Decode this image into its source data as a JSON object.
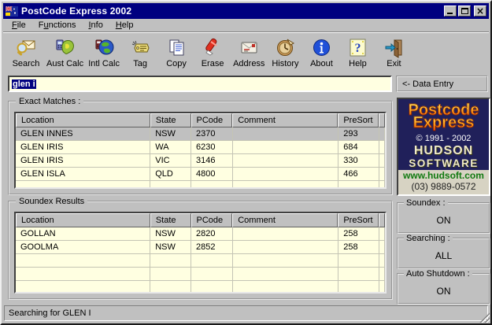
{
  "window": {
    "title": "PostCode Express 2002",
    "controls": [
      {
        "name": "minimize-button"
      },
      {
        "name": "maximize-button"
      },
      {
        "name": "close-button"
      }
    ]
  },
  "menu": [
    {
      "label": "File",
      "underline": 0
    },
    {
      "label": "Functions",
      "underline": 1
    },
    {
      "label": "Info",
      "underline": 0
    },
    {
      "label": "Help",
      "underline": 0
    }
  ],
  "toolbar": [
    {
      "label": "Search",
      "icon": "search-icon"
    },
    {
      "label": "Aust Calc",
      "icon": "aust-calc-icon"
    },
    {
      "label": "Intl Calc",
      "icon": "intl-calc-icon"
    },
    {
      "label": "Tag",
      "icon": "tag-icon"
    },
    {
      "label": "Copy",
      "icon": "copy-icon"
    },
    {
      "label": "Erase",
      "icon": "erase-icon"
    },
    {
      "label": "Address",
      "icon": "address-icon"
    },
    {
      "label": "History",
      "icon": "history-icon"
    },
    {
      "label": "About",
      "icon": "about-icon"
    },
    {
      "label": "Help",
      "icon": "help-icon"
    },
    {
      "label": "Exit",
      "icon": "exit-icon"
    }
  ],
  "entry": {
    "value": "glen i",
    "hint_label": "<- Data Entry"
  },
  "exact_matches": {
    "title": "Exact Matches :",
    "columns": [
      "Location",
      "State",
      "PCode",
      "Comment",
      "PreSort"
    ],
    "rows": [
      [
        "GLEN INNES",
        "NSW",
        "2370",
        "",
        "293"
      ],
      [
        "GLEN IRIS",
        "WA",
        "6230",
        "",
        "684"
      ],
      [
        "GLEN IRIS",
        "VIC",
        "3146",
        "",
        "330"
      ],
      [
        "GLEN ISLA",
        "QLD",
        "4800",
        "",
        "466"
      ]
    ],
    "selected_row": 0,
    "empty_rows": 3
  },
  "soundex_results": {
    "title": "Soundex Results",
    "columns": [
      "Location",
      "State",
      "PCode",
      "Comment",
      "PreSort"
    ],
    "rows": [
      [
        "GOLLAN",
        "NSW",
        "2820",
        "",
        "258"
      ],
      [
        "GOOLMA",
        "NSW",
        "2852",
        "",
        "258"
      ]
    ],
    "selected_row": -1,
    "empty_rows": 5
  },
  "brand": {
    "word1": "Postcode",
    "word2": "Express",
    "copyright": "©  1991 - 2002",
    "company_line1": "HUDSON",
    "company_line2": "SOFTWARE",
    "website": "www.hudsoft.com",
    "phone": "(03) 9889-0572"
  },
  "status_boxes": [
    {
      "label": "Soundex :",
      "value": "ON"
    },
    {
      "label": "Searching :",
      "value": "ALL"
    },
    {
      "label": "Auto Shutdown :",
      "value": "ON"
    }
  ],
  "statusbar": {
    "text": "Searching for GLEN I"
  },
  "colors": {
    "titlebar": "#000080",
    "window_bg": "#c0c0c0",
    "grid_bg": "#ffffe1",
    "selection": "#000080",
    "logo_bg": "#20205a",
    "website_green": "#117a11",
    "brand_orange": "#ff9900"
  }
}
